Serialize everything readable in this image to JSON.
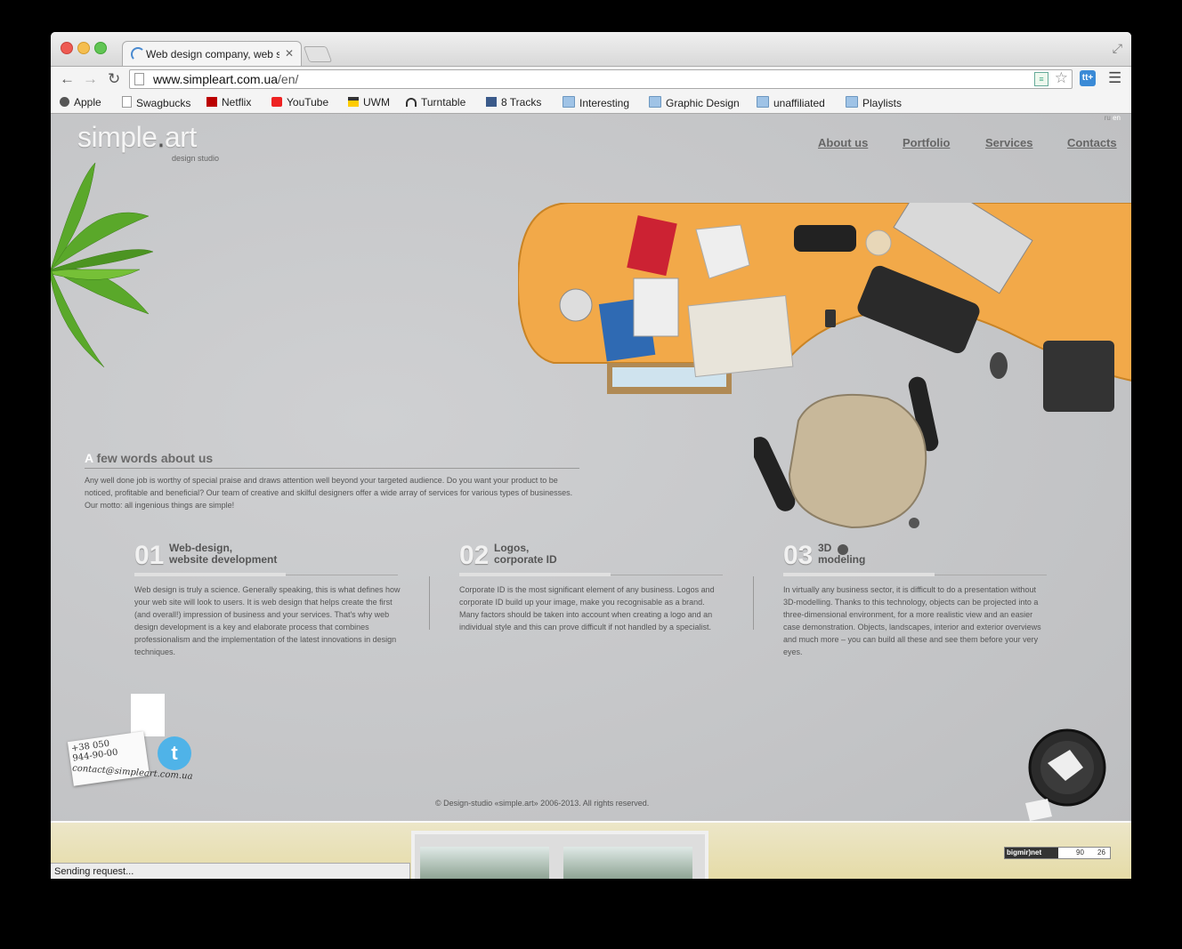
{
  "browser": {
    "tab_title": "Web design company, web s",
    "url_domain": "www.simpleart.com.ua",
    "url_path": "/en/",
    "bookmarks": [
      {
        "label": "Apple",
        "icon": "apple-icon"
      },
      {
        "label": "Swagbucks",
        "icon": "page-icon"
      },
      {
        "label": "Netflix",
        "icon": "netflix-icon"
      },
      {
        "label": "YouTube",
        "icon": "youtube-icon"
      },
      {
        "label": "UWM",
        "icon": "uwm-icon"
      },
      {
        "label": "Turntable",
        "icon": "headphones-icon"
      },
      {
        "label": "8 Tracks",
        "icon": "8tracks-icon"
      },
      {
        "label": "Interesting",
        "icon": "folder-icon"
      },
      {
        "label": "Graphic Design",
        "icon": "folder-icon"
      },
      {
        "label": "unaffiliated",
        "icon": "folder-icon"
      },
      {
        "label": "Playlists",
        "icon": "folder-icon"
      }
    ],
    "extension_label": "tt+",
    "status": "Sending request..."
  },
  "site": {
    "logo_main": "simple",
    "logo_dot": ".",
    "logo_tail": "art",
    "logo_sub": "design studio",
    "lang_ru": "ru",
    "lang_en": "en",
    "nav": [
      "About us",
      "Portfolio",
      "Services",
      "Contacts"
    ],
    "about": {
      "cap": "A",
      "heading": " few words about us",
      "text": "Any well done job is worthy of special praise and draws attention well beyond your targeted audience. Do you want your product to be noticed, profitable and beneficial? Our team of creative and skilful designers offer a wide array of services for various types of businesses. Our motto: all ingenious things are simple!"
    },
    "services": [
      {
        "num": "01",
        "title_1": "Web-design,",
        "title_2": "website development",
        "text": "Web design is truly a science. Generally speaking, this is what defines how your web site will look to users. It is web design that helps create the first (and overall!) impression of business and your services. That's why web design development is a key and elaborate process that combines professionalism and the implementation of the latest innovations in design techniques."
      },
      {
        "num": "02",
        "title_1": "Logos,",
        "title_2": "corporate ID",
        "text": "Corporate ID is the most significant element of any business. Logos and corporate ID build up your image, make you recognisable as a brand. Many factors should be taken into account when creating a logo and an individual style and this can prove difficult if not handled by a specialist."
      },
      {
        "num": "03",
        "title_1": "3D",
        "title_2": "modeling",
        "text": "In virtually any business sector, it is difficult to do a presentation without 3D-modelling. Thanks to this technology, objects can be projected into a three-dimensional environment, for a more realistic view and an easier case demonstration. Objects, landscapes, interior and exterior overviews and much more – you can build all these and see them before your very eyes."
      }
    ],
    "contact_phone_1": "+38 050",
    "contact_phone_2": "944-90-00",
    "contact_email": "contact@simpleart.com.ua",
    "copyright": "© Design-studio «simple.art» 2006-2013. All rights reserved.",
    "counter_brand": "bigmir)net",
    "counter_v1": "90",
    "counter_v2": "26"
  },
  "colors": {
    "accent_desk": "#f2a949",
    "page_bg": "#c6c7c9"
  }
}
